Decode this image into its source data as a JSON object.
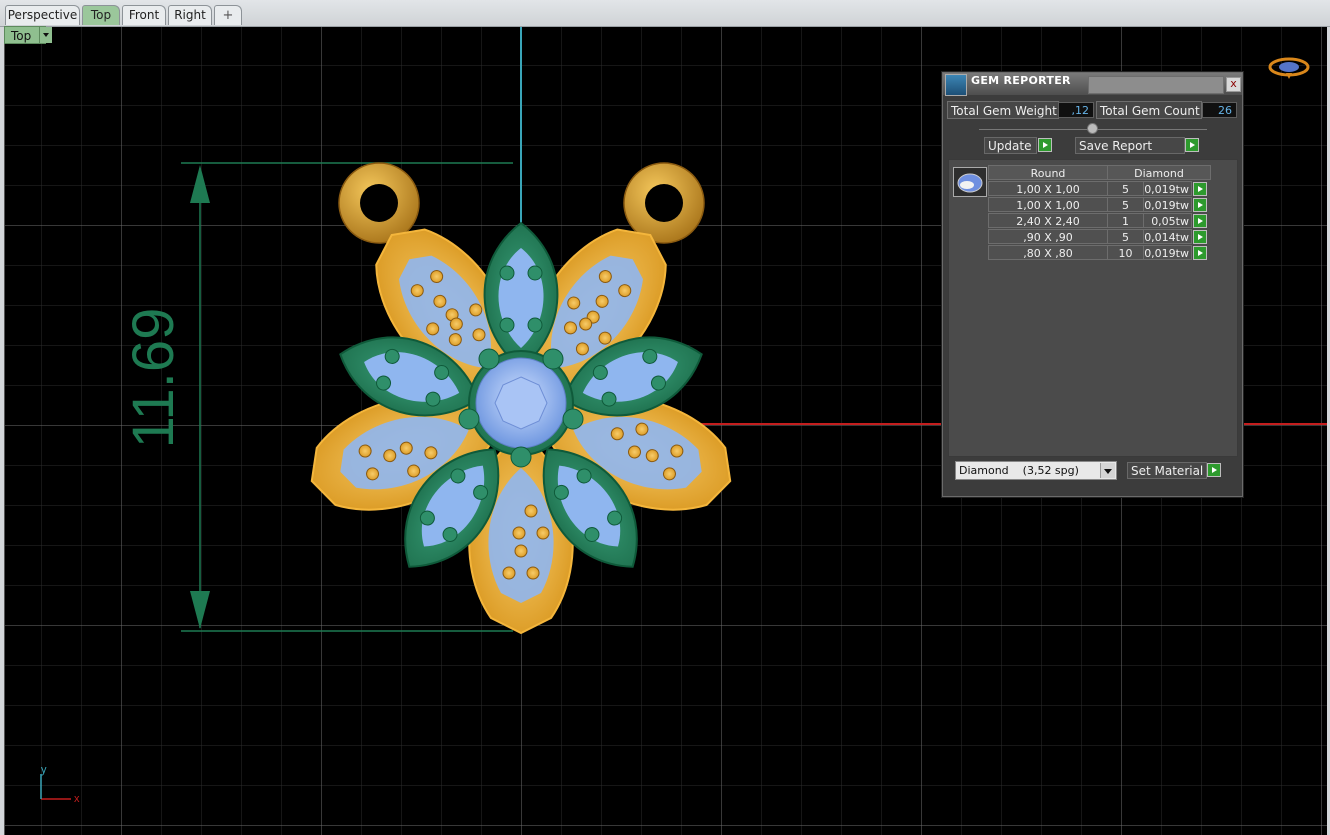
{
  "tabs": [
    {
      "label": "Perspective",
      "active": false
    },
    {
      "label": "Top",
      "active": true
    },
    {
      "label": "Front",
      "active": false
    },
    {
      "label": "Right",
      "active": false
    },
    {
      "label": "+",
      "active": false
    }
  ],
  "viewport": {
    "label": "Top",
    "dimension_text": "11.69",
    "axis_x": "x",
    "axis_y": "y",
    "colors": {
      "background": "#000000",
      "grid": "#3a3a3a",
      "grid_major": "#7a7a7a",
      "x_axis": "#c41e1e",
      "y_axis": "#3aa6b9",
      "gold": "#f1b43e",
      "green": "#23805a",
      "gem": "#8fb6ef",
      "dimension": "#1e7a52"
    }
  },
  "gem_reporter": {
    "title": "GEM REPORTER",
    "close_label": "x",
    "total_weight_label": "Total Gem Weight",
    "total_weight_value": ",12",
    "total_count_label": "Total Gem Count",
    "total_count_value": "26",
    "update_label": "Update",
    "save_report_label": "Save Report",
    "table": {
      "headers": [
        "Round",
        "Diamond"
      ],
      "rows": [
        {
          "size": "1,00 X 1,00",
          "count": "5",
          "weight": "0,019tw"
        },
        {
          "size": "1,00 X 1,00",
          "count": "5",
          "weight": "0,019tw"
        },
        {
          "size": "2,40 X 2,40",
          "count": "1",
          "weight": "0,05tw"
        },
        {
          "size": ",90 X ,90",
          "count": "5",
          "weight": "0,014tw"
        },
        {
          "size": ",80 X ,80",
          "count": "10",
          "weight": "0,019tw"
        }
      ]
    },
    "material_select": "Diamond    (3,52 spg)",
    "set_material_label": "Set Material"
  }
}
